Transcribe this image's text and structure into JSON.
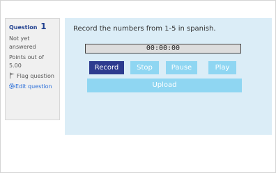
{
  "question_info": {
    "question_label": "Question",
    "question_number": "1",
    "state": "Not yet answered",
    "grade": "Points out of 5.00",
    "flag_label": "Flag question",
    "edit_label": "Edit question"
  },
  "question": {
    "text": "Record the numbers from 1-5 in spanish.",
    "timer": "00:00:00",
    "buttons": {
      "record": "Record",
      "stop": "Stop",
      "pause": "Pause",
      "play": "Play",
      "upload": "Upload"
    }
  },
  "colors": {
    "content_background": "#dbedf7",
    "record_button": "#2d3b8f",
    "disabled_button": "#8fd6f2",
    "link": "#2a6ed8"
  }
}
